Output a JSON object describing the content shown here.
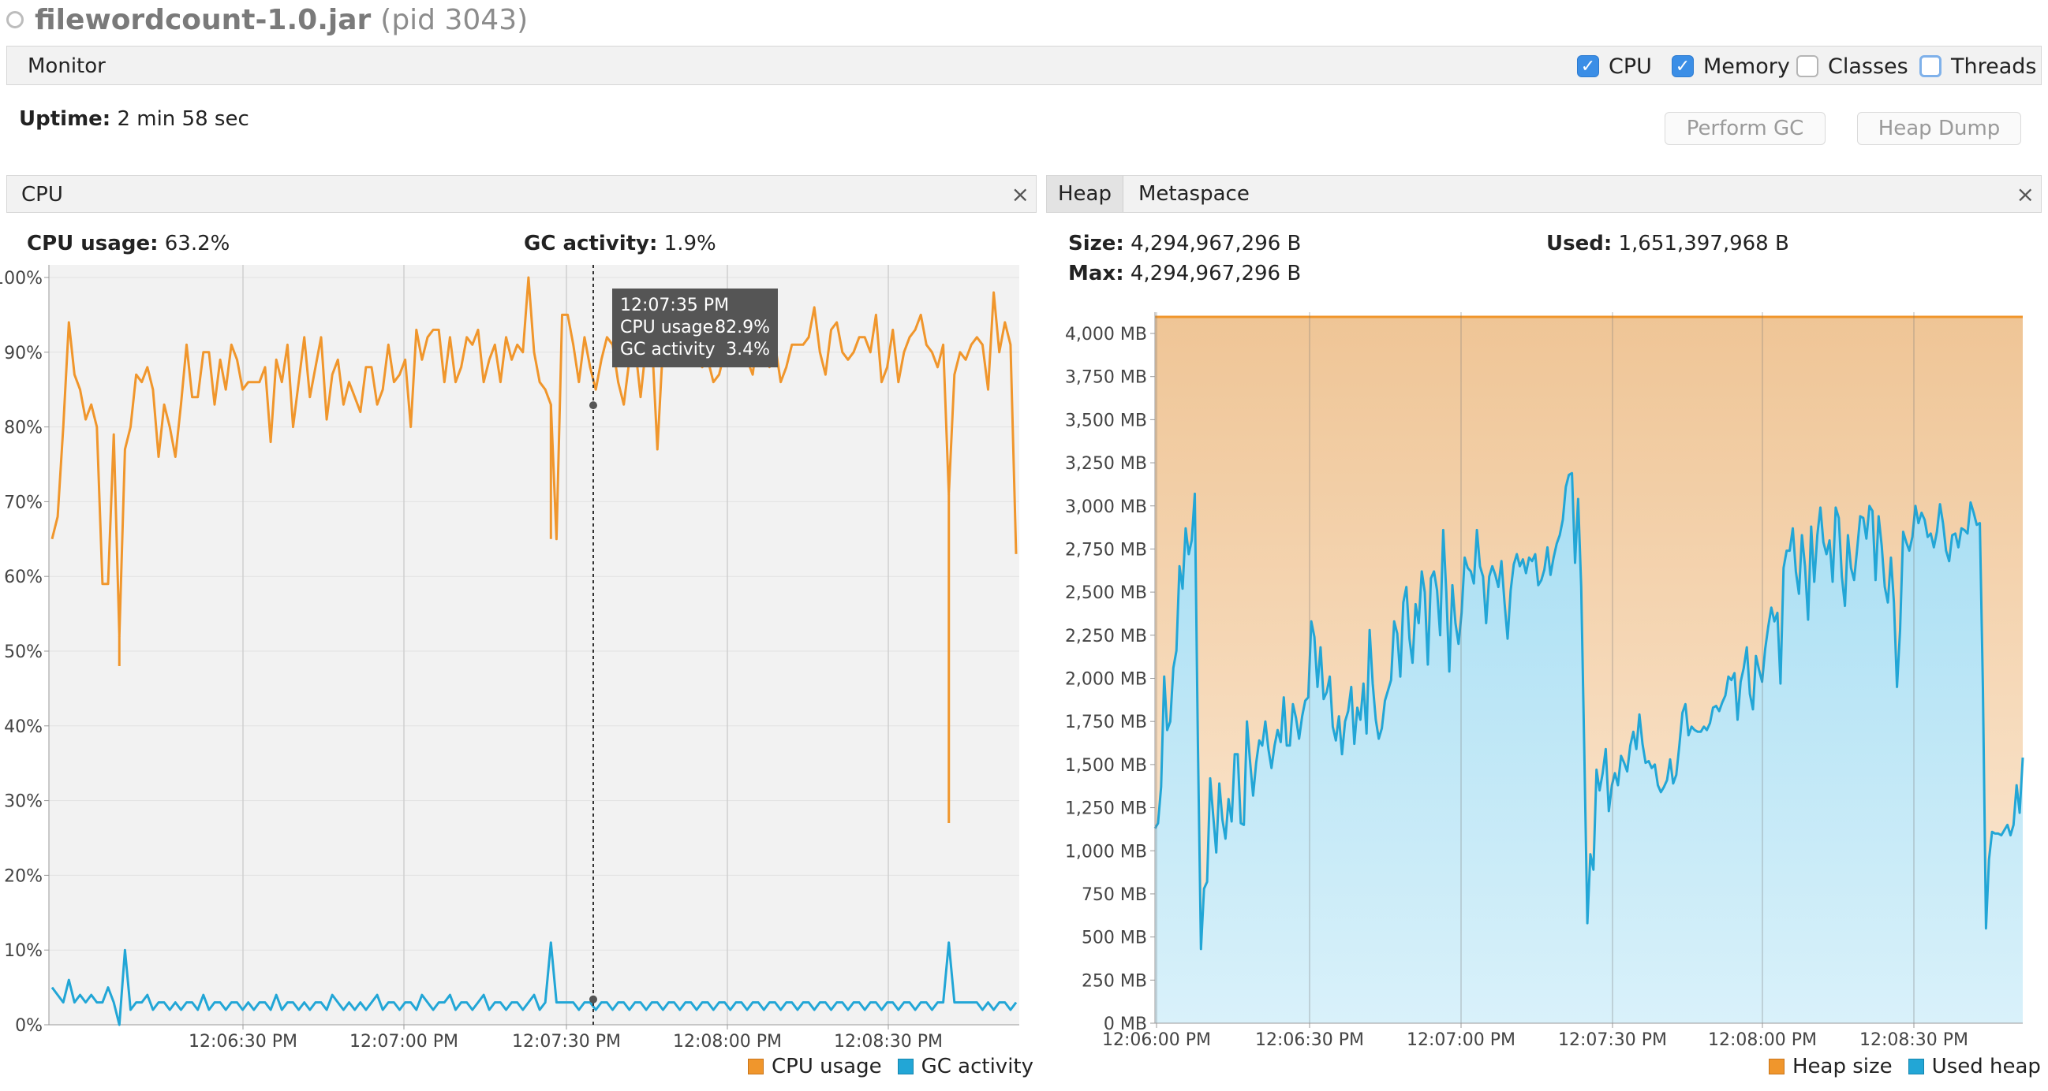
{
  "window": {
    "app_name": "filewordcount-1.0.jar",
    "pid": "(pid 3043)"
  },
  "monitor_bar": {
    "label": "Monitor",
    "checkboxes": [
      {
        "label": "CPU",
        "checked": true
      },
      {
        "label": "Memory",
        "checked": true
      },
      {
        "label": "Classes",
        "checked": false
      },
      {
        "label": "Threads",
        "checked": false
      }
    ]
  },
  "uptime": {
    "label": "Uptime:",
    "value": "2 min 58 sec"
  },
  "buttons": {
    "perform_gc": "Perform GC",
    "heap_dump": "Heap Dump"
  },
  "cpu_panel": {
    "tab": "CPU",
    "close": "×",
    "cpu_usage_label": "CPU usage:",
    "cpu_usage_value": "63.2%",
    "gc_activity_label": "GC activity:",
    "gc_activity_value": "1.9%",
    "tooltip": {
      "time": "12:07:35 PM",
      "cpu_label": "CPU usage",
      "cpu_value": "82.9%",
      "gc_label": "GC activity",
      "gc_value": "3.4%"
    },
    "legend": [
      {
        "label": "CPU usage",
        "color": "#f0962c"
      },
      {
        "label": "GC activity",
        "color": "#22a6d6"
      }
    ]
  },
  "memory_panel": {
    "tabs": [
      "Heap",
      "Metaspace"
    ],
    "close": "×",
    "size_label": "Size:",
    "size_value": "4,294,967,296 B",
    "max_label": "Max:",
    "max_value": "4,294,967,296 B",
    "used_label": "Used:",
    "used_value": "1,651,397,968 B",
    "legend": [
      {
        "label": "Heap size",
        "color": "#f0962c"
      },
      {
        "label": "Used heap",
        "color": "#22a6d6"
      }
    ]
  },
  "chart_data": [
    {
      "type": "line",
      "title": "CPU",
      "xlabel": "",
      "ylabel": "",
      "ylim": [
        0,
        100
      ],
      "y_tick_labels": [
        "0%",
        "10%",
        "20%",
        "30%",
        "40%",
        "50%",
        "60%",
        "70%",
        "80%",
        "90%",
        "100%"
      ],
      "x_tick_labels": [
        "12:06:30 PM",
        "12:07:00 PM",
        "12:07:30 PM",
        "12:08:00 PM",
        "12:08:30 PM"
      ],
      "grid": true,
      "legend_position": "bottom-right",
      "series": [
        {
          "name": "CPU usage",
          "color": "#f0962c",
          "values": [
            65,
            68,
            80,
            94,
            87,
            85,
            81,
            83,
            80,
            59,
            59,
            79,
            52,
            77,
            80,
            87,
            86,
            88,
            85,
            76,
            83,
            80,
            76,
            83,
            91,
            84,
            84,
            90,
            90,
            83,
            89,
            85,
            91,
            89,
            85,
            86,
            86,
            86,
            88,
            78,
            89,
            86,
            91,
            80,
            86,
            92,
            84,
            88,
            92,
            81,
            87,
            89,
            83,
            86,
            84,
            82,
            88,
            88,
            83,
            85,
            91,
            86,
            87,
            89,
            80,
            93,
            89,
            92,
            93,
            93,
            86,
            92,
            86,
            88,
            92,
            91,
            93,
            86,
            89,
            91,
            86,
            92,
            89,
            91,
            90,
            100,
            90,
            86,
            85,
            83,
            65,
            95,
            95,
            91,
            86,
            92,
            88,
            85,
            89,
            92,
            91,
            86,
            83,
            89,
            91,
            84,
            91,
            92,
            77,
            91,
            95,
            90,
            89,
            92,
            91,
            93,
            88,
            89,
            86,
            87,
            90,
            91,
            95,
            91,
            89,
            87,
            93,
            93,
            88,
            91,
            86,
            88,
            91,
            91,
            91,
            92,
            96,
            90,
            87,
            93,
            94,
            90,
            89,
            90,
            92,
            92,
            90,
            95,
            86,
            88,
            93,
            86,
            90,
            92,
            93,
            95,
            91,
            90,
            88,
            91,
            71,
            87,
            90,
            89,
            91,
            92,
            91,
            85,
            98,
            90,
            94,
            91,
            63
          ],
          "dips": [
            {
              "time_index": 12,
              "value": 48
            },
            {
              "time_index": 89,
              "value": 65
            },
            {
              "time_index": 160,
              "value": 27
            }
          ]
        },
        {
          "name": "GC activity",
          "color": "#22a6d6",
          "values": [
            5,
            4,
            3,
            6,
            3,
            4,
            3,
            4,
            3,
            3,
            5,
            3,
            0,
            10,
            2,
            3,
            3,
            4,
            2,
            3,
            3,
            2,
            3,
            2,
            3,
            3,
            2,
            4,
            2,
            3,
            3,
            2,
            3,
            3,
            2,
            3,
            2,
            3,
            3,
            2,
            4,
            2,
            3,
            3,
            2,
            3,
            2,
            3,
            3,
            2,
            4,
            3,
            2,
            3,
            2,
            3,
            2,
            3,
            4,
            2,
            3,
            3,
            2,
            3,
            3,
            2,
            4,
            3,
            2,
            3,
            3,
            4,
            2,
            3,
            3,
            2,
            3,
            4,
            2,
            3,
            3,
            2,
            3,
            3,
            2,
            3,
            4,
            2,
            3,
            11,
            3,
            3,
            3,
            3,
            2,
            3,
            3,
            2,
            3,
            3,
            2,
            3,
            3,
            2,
            3,
            3,
            2,
            3,
            3,
            2,
            3,
            3,
            2,
            3,
            3,
            2,
            3,
            3,
            2,
            3,
            3,
            2,
            3,
            3,
            2,
            3,
            3,
            2,
            3,
            3,
            2,
            3,
            3,
            2,
            3,
            3,
            2,
            3,
            3,
            2,
            3,
            3,
            2,
            3,
            3,
            2,
            3,
            3,
            2,
            3,
            3,
            2,
            3,
            3,
            2,
            3,
            3,
            2,
            3,
            3,
            11,
            3,
            3,
            3,
            3,
            3,
            2,
            3,
            2,
            3,
            3,
            2,
            3
          ]
        }
      ]
    },
    {
      "type": "area",
      "title": "Heap",
      "xlabel": "",
      "ylabel": "",
      "ylim": [
        0,
        4096
      ],
      "y_tick_labels": [
        "0 MB",
        "250 MB",
        "500 MB",
        "750 MB",
        "1,000 MB",
        "1,250 MB",
        "1,500 MB",
        "1,750 MB",
        "2,000 MB",
        "2,250 MB",
        "2,500 MB",
        "2,750 MB",
        "3,000 MB",
        "3,250 MB",
        "3,500 MB",
        "3,750 MB",
        "4,000 MB"
      ],
      "x_tick_labels": [
        "12:06:00 PM",
        "12:06:30 PM",
        "12:07:00 PM",
        "12:07:30 PM",
        "12:08:00 PM",
        "12:08:30 PM"
      ],
      "grid": true,
      "legend_position": "bottom-right",
      "series": [
        {
          "name": "Heap size",
          "color": "#f0962c",
          "values_mb": [
            4096,
            4096
          ]
        },
        {
          "name": "Used heap",
          "color": "#22a6d6",
          "values_mb": [
            1130,
            1160,
            1370,
            2010,
            1700,
            1750,
            2060,
            2160,
            2650,
            2520,
            2870,
            2720,
            2800,
            3070,
            1630,
            430,
            780,
            820,
            1420,
            1200,
            990,
            1390,
            1180,
            1070,
            1300,
            1170,
            1560,
            1560,
            1160,
            1150,
            1750,
            1520,
            1320,
            1510,
            1640,
            1610,
            1750,
            1590,
            1480,
            1610,
            1700,
            1630,
            1890,
            1610,
            1610,
            1850,
            1770,
            1650,
            1780,
            1870,
            1890,
            2330,
            2240,
            1950,
            2180,
            1880,
            1920,
            2010,
            1720,
            1640,
            1780,
            1560,
            1750,
            1810,
            1950,
            1620,
            1830,
            1760,
            1970,
            1680,
            2280,
            1970,
            1760,
            1650,
            1710,
            1870,
            1930,
            1990,
            2330,
            2260,
            2010,
            2440,
            2530,
            2230,
            2090,
            2430,
            2320,
            2620,
            2500,
            2080,
            2580,
            2620,
            2510,
            2250,
            2860,
            2500,
            2040,
            2540,
            2320,
            2200,
            2380,
            2700,
            2640,
            2620,
            2550,
            2860,
            2650,
            2590,
            2320,
            2590,
            2650,
            2600,
            2530,
            2680,
            2440,
            2230,
            2510,
            2660,
            2720,
            2650,
            2690,
            2610,
            2700,
            2680,
            2720,
            2540,
            2570,
            2630,
            2760,
            2600,
            2700,
            2780,
            2830,
            2920,
            3110,
            3180,
            3190,
            2670,
            3040,
            2530,
            1580,
            580,
            980,
            890,
            1470,
            1350,
            1450,
            1590,
            1230,
            1380,
            1450,
            1380,
            1550,
            1510,
            1460,
            1610,
            1690,
            1590,
            1790,
            1620,
            1510,
            1520,
            1480,
            1500,
            1380,
            1340,
            1370,
            1410,
            1530,
            1390,
            1440,
            1610,
            1800,
            1850,
            1670,
            1720,
            1700,
            1690,
            1690,
            1720,
            1700,
            1740,
            1830,
            1840,
            1810,
            1860,
            1900,
            2010,
            1990,
            2030,
            1760,
            1980,
            2060,
            2180,
            1910,
            1820,
            2130,
            2050,
            1980,
            2170,
            2300,
            2410,
            2330,
            2380,
            1970,
            2640,
            2740,
            2740,
            2870,
            2620,
            2490,
            2830,
            2650,
            2340,
            2880,
            2560,
            2830,
            2990,
            2790,
            2720,
            2800,
            2560,
            2990,
            2930,
            2590,
            2420,
            2830,
            2640,
            2570,
            2750,
            2940,
            2930,
            2810,
            3000,
            2970,
            2570,
            2940,
            2770,
            2530,
            2440,
            2700,
            2440,
            1950,
            2280,
            2850,
            2790,
            2740,
            2820,
            3000,
            2900,
            2960,
            2920,
            2820,
            2840,
            2760,
            2850,
            3010,
            2900,
            2740,
            2680,
            2830,
            2840,
            2760,
            2870,
            2860,
            2840,
            3020,
            2960,
            2890,
            2900,
            1940,
            550,
            950,
            1110,
            1100,
            1100,
            1090,
            1120,
            1150,
            1090,
            1150,
            1380,
            1220,
            1540
          ]
        }
      ]
    }
  ]
}
